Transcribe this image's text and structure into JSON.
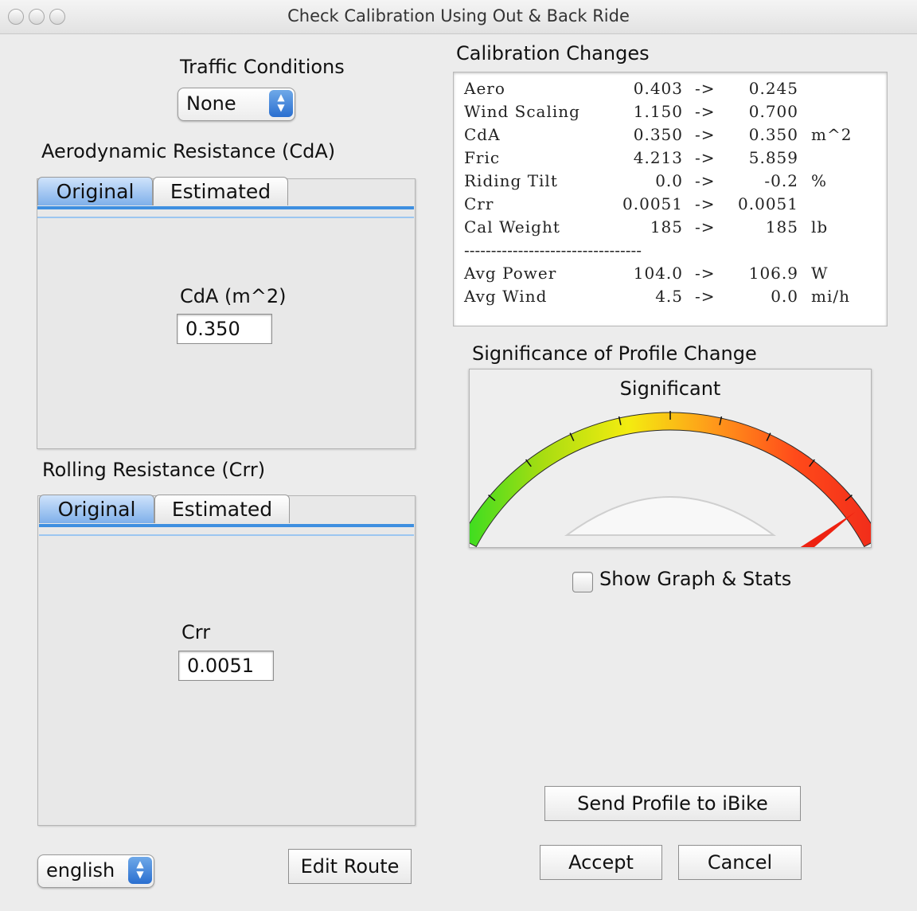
{
  "window": {
    "title": "Check Calibration Using Out & Back Ride"
  },
  "traffic": {
    "label": "Traffic Conditions",
    "selected": "None"
  },
  "aero": {
    "label": "Aerodynamic Resistance (CdA)",
    "tabs": [
      "Original",
      "Estimated"
    ],
    "field_label": "CdA (m^2)",
    "field_value": "0.350"
  },
  "rolling": {
    "label": "Rolling Resistance (Crr)",
    "tabs": [
      "Original",
      "Estimated"
    ],
    "field_label": "Crr",
    "field_value": "0.0051"
  },
  "language": {
    "selected": "english"
  },
  "buttons": {
    "edit_route": "Edit Route",
    "send_profile": "Send Profile to iBike",
    "accept": "Accept",
    "cancel": "Cancel"
  },
  "calibration": {
    "title": "Calibration Changes",
    "rows": [
      {
        "name": "Aero",
        "from": "0.403",
        "arrow": "->",
        "to": "0.245",
        "unit": ""
      },
      {
        "name": "Wind Scaling",
        "from": "1.150",
        "arrow": "->",
        "to": "0.700",
        "unit": ""
      },
      {
        "name": "CdA",
        "from": "0.350",
        "arrow": "->",
        "to": "0.350",
        "unit": "m^2"
      },
      {
        "name": "Fric",
        "from": "4.213",
        "arrow": "->",
        "to": "5.859",
        "unit": ""
      },
      {
        "name": "Riding Tilt",
        "from": "0.0",
        "arrow": "->",
        "to": "-0.2",
        "unit": "%"
      },
      {
        "name": "Crr",
        "from": "0.0051",
        "arrow": "->",
        "to": "0.0051",
        "unit": ""
      },
      {
        "name": "Cal Weight",
        "from": "185",
        "arrow": "->",
        "to": "185",
        "unit": "lb"
      }
    ],
    "separator": "---------------------------------",
    "summary_rows": [
      {
        "name": "Avg Power",
        "from": "104.0",
        "arrow": "->",
        "to": "106.9",
        "unit": "W"
      },
      {
        "name": "Avg Wind",
        "from": "4.5",
        "arrow": "->",
        "to": "0.0",
        "unit": "mi/h"
      }
    ]
  },
  "significance": {
    "title": "Significance of Profile Change",
    "value_label": "Significant",
    "needle_fraction": 0.93,
    "gauge_colors": [
      "#33dd22",
      "#aadd11",
      "#f4ec10",
      "#ff9a1a",
      "#ff4a1a",
      "#f02a1a"
    ]
  },
  "show_graph": {
    "label": "Show Graph & Stats",
    "checked": false
  }
}
